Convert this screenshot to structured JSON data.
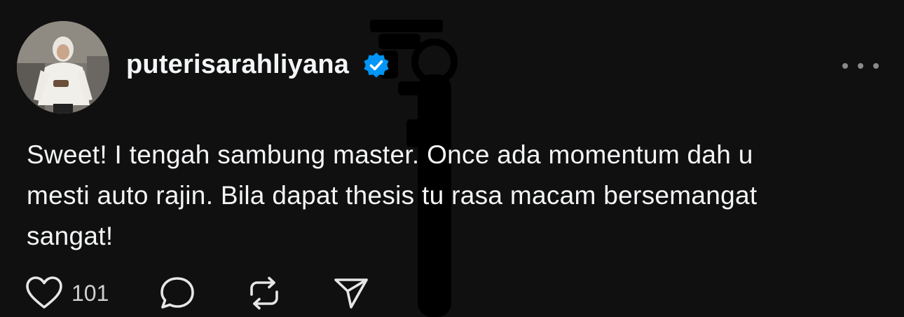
{
  "post": {
    "username": "puterisarahliyana",
    "verified": true,
    "avatar_alt": "avatar",
    "body_lines": [
      "Sweet! I tengah sambung master. Once ada momentum dah u",
      "mesti auto rajin. Bila dapat thesis tu rasa macam bersemangat",
      "sangat!"
    ]
  },
  "actions": {
    "like_count": "101",
    "icons": [
      "heart-icon",
      "comment-icon",
      "repost-icon",
      "share-icon"
    ]
  },
  "colors": {
    "background": "#101010",
    "text": "#f3f5f7",
    "verified_blue": "#0095f6",
    "muted": "#8a8a8a"
  }
}
